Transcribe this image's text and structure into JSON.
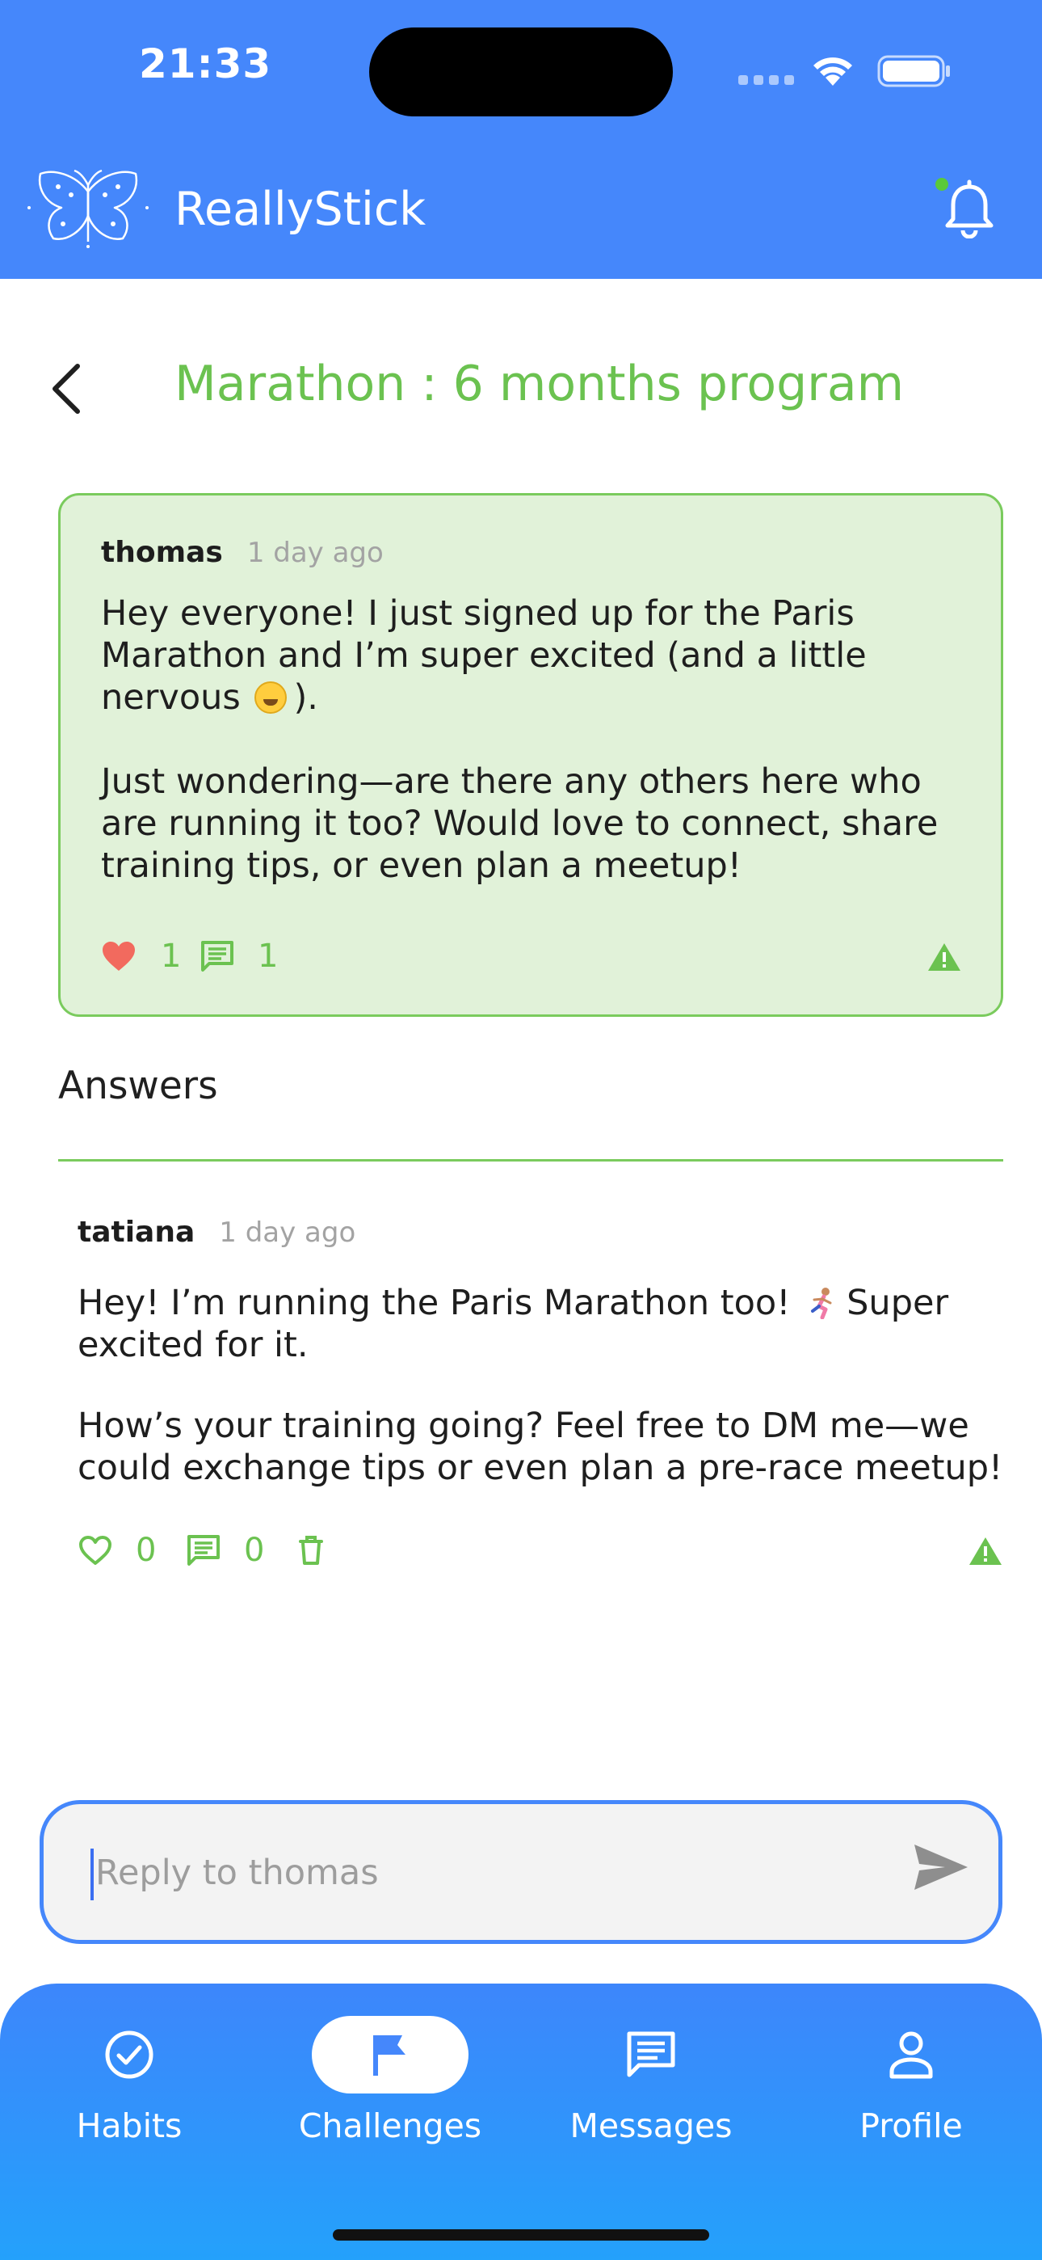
{
  "status_bar": {
    "time": "21:33"
  },
  "header": {
    "app_name": "ReallyStick"
  },
  "page": {
    "title": "Marathon : 6 months program"
  },
  "post": {
    "author": "thomas",
    "time_ago": "1 day ago",
    "paragraph_1": "Hey everyone! I just signed up for the Paris Marathon and I’m super excited (and a little nervous",
    "paragraph_1_end": ").",
    "paragraph_2": "Just wondering—are there any others here who are running it too? Would love to connect, share training tips, or even plan a meetup!",
    "likes": "1",
    "comments": "1"
  },
  "answers": {
    "heading": "Answers",
    "items": [
      {
        "author": "tatiana",
        "time_ago": "1 day ago",
        "paragraph_1": "Hey! I’m running the Paris Marathon too!",
        "paragraph_1_end": "Super excited for it.",
        "paragraph_2": "How’s your training going? Feel free to DM me—we could exchange tips or even plan a pre-race meetup!",
        "likes": "0",
        "comments": "0"
      }
    ]
  },
  "reply": {
    "placeholder": "Reply to thomas",
    "value": ""
  },
  "nav": {
    "items": [
      {
        "label": "Habits",
        "icon": "check-circle-icon"
      },
      {
        "label": "Challenges",
        "icon": "flag-icon",
        "active": true
      },
      {
        "label": "Messages",
        "icon": "message-icon"
      },
      {
        "label": "Profile",
        "icon": "person-icon"
      }
    ]
  },
  "colors": {
    "primary_blue": "#4587fb",
    "accent_green": "#6bc250",
    "card_green_bg": "#e1f2d9",
    "like_red": "#f26a5e"
  }
}
